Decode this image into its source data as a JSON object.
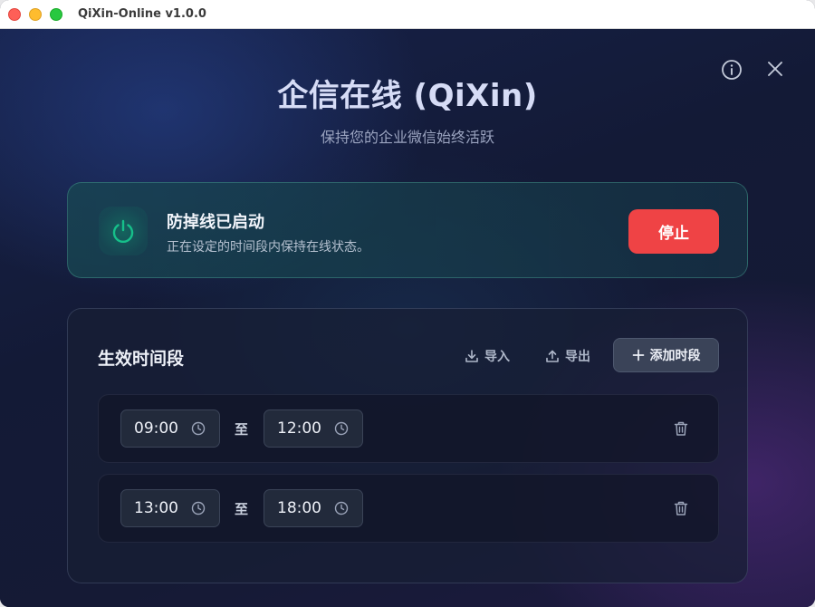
{
  "window": {
    "title": "QiXin-Online v1.0.0"
  },
  "header": {
    "title": "企信在线 (QiXin)",
    "subtitle": "保持您的企业微信始终活跃",
    "info_icon": "info-icon",
    "close_icon": "close-icon"
  },
  "status": {
    "icon": "power-icon",
    "title": "防掉线已启动",
    "description": "正在设定的时间段内保持在线状态。",
    "stop_label": "停止",
    "accent_color": "#10b981",
    "stop_color": "#ef4345"
  },
  "schedule": {
    "title": "生效时间段",
    "import_label": "导入",
    "export_label": "导出",
    "add_label": "添加时段",
    "separator": "至",
    "slots": [
      {
        "start": "09:00",
        "end": "12:00"
      },
      {
        "start": "13:00",
        "end": "18:00"
      }
    ]
  }
}
